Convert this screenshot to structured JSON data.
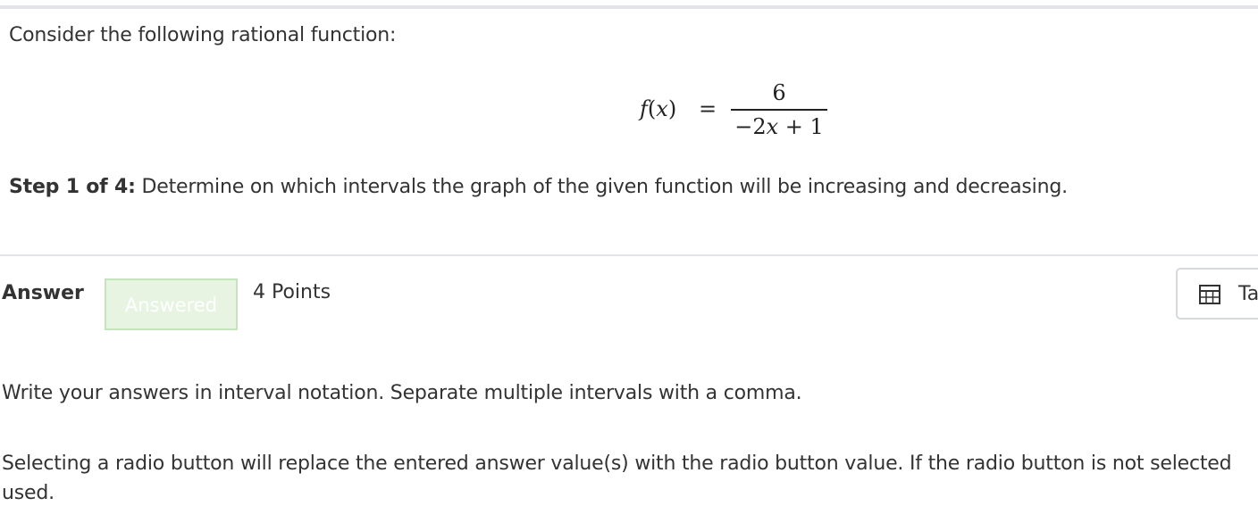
{
  "question": {
    "intro": "Consider the following rational function:",
    "equation": {
      "lhs_name": "f",
      "lhs_open": "(",
      "lhs_var": "x",
      "lhs_close": ")",
      "equals": "=",
      "numerator": "6",
      "denominator_sign": "−",
      "denominator_coef": "2",
      "denominator_var": "x",
      "denominator_rest": " + 1"
    },
    "step_label": "Step 1 of 4:",
    "step_text": " Determine on which intervals the graph of the given function will be increasing and decreasing."
  },
  "answer_bar": {
    "answer_label": "Answer",
    "status_badge": "Answered",
    "points": "4 Points",
    "table_button_label": "Ta",
    "table_icon": "table-grid-icon"
  },
  "instructions": {
    "line1": "Write your answers in interval notation. Separate multiple intervals with a comma.",
    "line2a": "Selecting a radio button will replace the entered answer value(s) with the radio button value. If the radio button is not selected",
    "line2b": "used."
  },
  "colors": {
    "text": "#333333",
    "rule": "#e2e4e7",
    "badge_bg": "#e6f4e1",
    "badge_border": "#c5e3bd"
  }
}
